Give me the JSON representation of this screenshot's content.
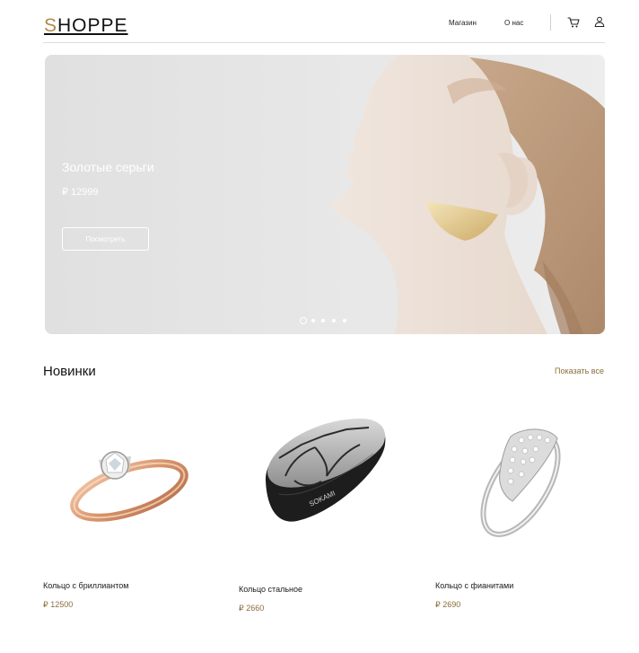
{
  "header": {
    "logo": "SHOPPE",
    "nav": {
      "shop": "Магазин",
      "about": "О нас"
    },
    "icons": {
      "cart": "cart-icon",
      "user": "user-icon"
    }
  },
  "hero": {
    "title": "Золотые серьги",
    "price": "₽ 12999",
    "button_label": "Посмотреть",
    "slides_count": 5,
    "active_slide": 1
  },
  "new_arrivals": {
    "title": "Новинки",
    "show_all": "Показать все",
    "products": [
      {
        "name": "Кольцо с бриллиантом",
        "price": "₽ 12500"
      },
      {
        "name": "Кольцо стальное",
        "price": "₽ 2660"
      },
      {
        "name": "Кольцо с фианитами",
        "price": "₽ 2690"
      }
    ]
  },
  "colors": {
    "accent": "#b08a48",
    "price": "#8a6d3b",
    "divider": "#dcdcdc",
    "hero_bg": "#e3e3e3"
  }
}
